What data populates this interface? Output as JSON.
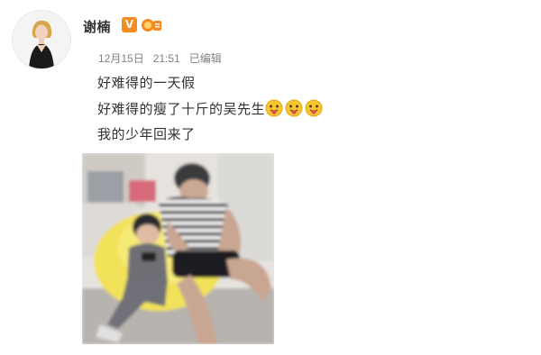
{
  "user": {
    "name": "谢楠",
    "verified_mark": "V"
  },
  "post": {
    "date": "12月15日",
    "time": "21:51",
    "edited_label": "已编辑",
    "lines": [
      "好难得的一天假",
      "好难得的瘦了十斤的吴先生",
      "我的少年回来了"
    ],
    "emoji_count": 3
  },
  "colors": {
    "badge_orange": "#f68b1f",
    "emoji_yellow": "#f7c62f",
    "text": "#333333",
    "meta_gray": "#808080"
  }
}
